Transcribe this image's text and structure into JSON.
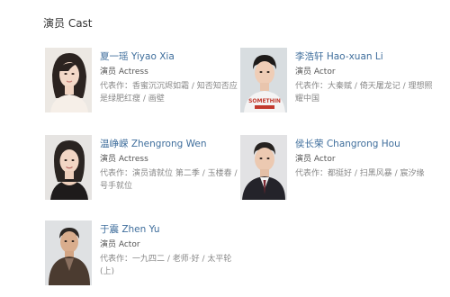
{
  "section": {
    "title": "演员 Cast"
  },
  "cast": [
    {
      "name": "夏一瑶 Yiyao Xia",
      "role": "演员 Actress",
      "works_label": "代表作：",
      "works": "香蜜沉沉烬如霜 / 知否知否应是绿肥红瘦 / 画壁"
    },
    {
      "name": "李浩轩 Hao-xuan Li",
      "role": "演员 Actor",
      "works_label": "代表作：",
      "works": "大秦赋 / 倚天屠龙记 / 理想照耀中国"
    },
    {
      "name": "温峥嵘 Zhengrong Wen",
      "role": "演员 Actress",
      "works_label": "代表作：",
      "works": "演员请就位 第二季 / 玉楼春 / 号手就位"
    },
    {
      "name": "侯长荣 Changrong Hou",
      "role": "演员 Actor",
      "works_label": "代表作：",
      "works": "都挺好 / 扫黑风暴 / 宸汐缘"
    },
    {
      "name": "于震 Zhen Yu",
      "role": "演员 Actor",
      "works_label": "代表作：",
      "works": "一九四二 / 老师·好 / 太平轮(上)"
    }
  ],
  "colors": {
    "name_link": "#3f6e9c",
    "meta": "#555555",
    "works": "#888888"
  }
}
